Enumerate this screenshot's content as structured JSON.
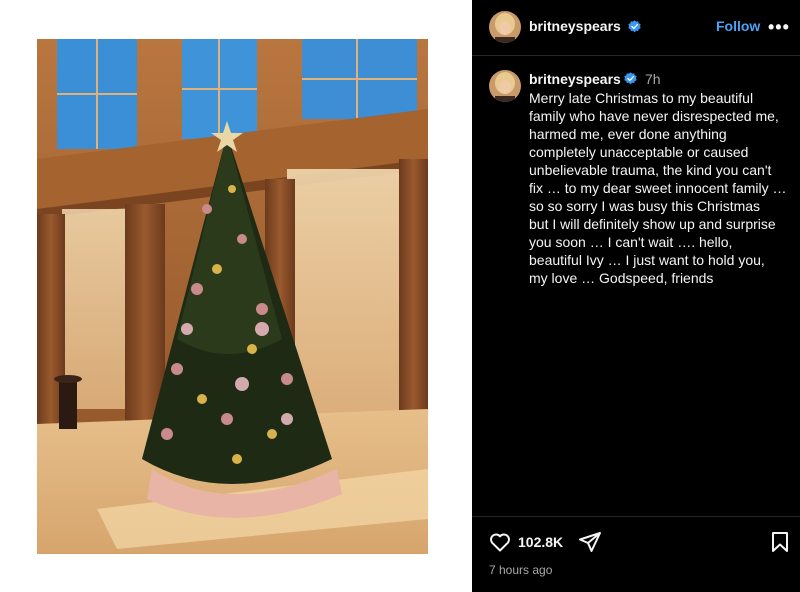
{
  "post": {
    "image_alt": "Decorated Christmas tree in a sunlit room with tall windows",
    "author": {
      "username": "britneyspears",
      "verified": true
    },
    "header": {
      "follow_label": "Follow",
      "more_label": "•••"
    },
    "caption": {
      "time_ago": "7h",
      "lines": [
        "Merry late Christmas to my beautiful",
        "family who have never disrespected me,",
        "harmed me, ever done anything",
        "completely unacceptable or caused",
        "unbelievable trauma, the kind you can't",
        "fix … to my dear sweet innocent family …",
        "so so sorry I was busy this Christmas",
        "but I will definitely show up and surprise",
        "you soon …  I can't wait …. hello,",
        "beautiful Ivy … I just want to hold you,",
        "my love … Godspeed, friends"
      ]
    },
    "likes_count": "102.8K",
    "timestamp": "7 hours ago"
  },
  "icons": {
    "like": "heart-icon",
    "share": "paper-plane-icon",
    "save": "bookmark-icon",
    "verified": "verified-badge-icon",
    "more": "more-options-icon"
  },
  "colors": {
    "background_dark": "#000000",
    "follow_blue": "#4aa3f5",
    "verified_blue": "#3897f0",
    "text_primary": "#f5f5f5",
    "text_secondary": "#a8a8a8"
  }
}
